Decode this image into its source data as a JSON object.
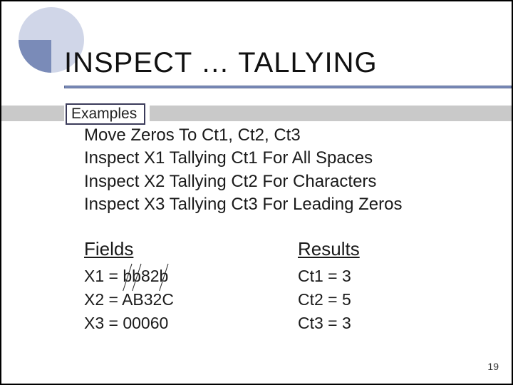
{
  "title": "INSPECT … TALLYING",
  "examples_label": "Examples",
  "code": {
    "l1": "Move Zeros To Ct1, Ct2, Ct3",
    "l2": "Inspect X1 Tallying Ct1 For All Spaces",
    "l3": "Inspect X2 Tallying Ct2 For Characters",
    "l4": "Inspect X3 Tallying Ct3 For Leading Zeros"
  },
  "fields": {
    "header": "Fields",
    "x1_prefix": "X1 = ",
    "x1_b1": "b",
    "x1_b2": "b",
    "x1_mid": "82",
    "x1_b3": "b",
    "x2": "X2 = AB32C",
    "x3": "X3 = 00060"
  },
  "results": {
    "header": "Results",
    "r1": "Ct1 = 3",
    "r2": "Ct2 = 5",
    "r3": "Ct3 = 3"
  },
  "page_number": "19"
}
